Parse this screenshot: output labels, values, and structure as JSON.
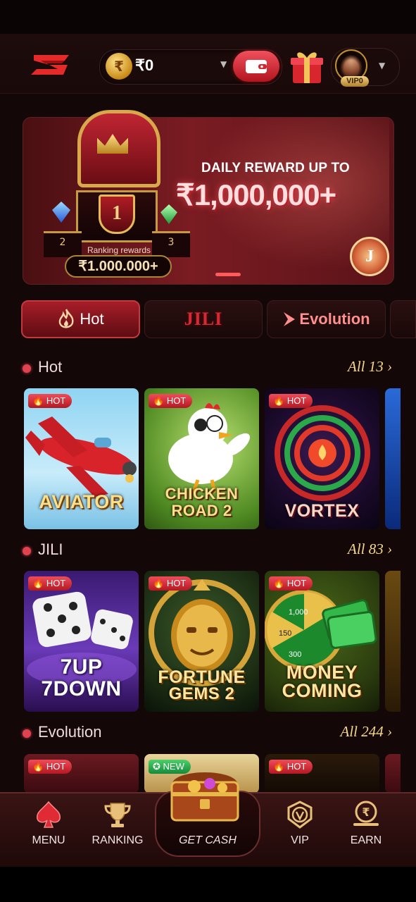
{
  "header": {
    "currency_symbol": "₹",
    "balance": "₹0",
    "vip_badge": "VIP0"
  },
  "banner": {
    "headline": "DAILY REWARD UP TO",
    "amount": "₹1,000,000+",
    "podium_first": "1",
    "podium_second": "2",
    "podium_third": "3",
    "ranking_label": "Ranking rewards",
    "ranking_amount": "₹1.000.000+"
  },
  "tabs": [
    {
      "label": "Hot",
      "active": true
    },
    {
      "label": "JILI",
      "active": false
    },
    {
      "label": "Evolution",
      "active": false
    }
  ],
  "sections": {
    "hot": {
      "title": "Hot",
      "all": "All 13",
      "games": [
        {
          "badge": "HOT",
          "title": "AVIATOR"
        },
        {
          "badge": "HOT",
          "title": "CHICKEN ROAD 2"
        },
        {
          "badge": "HOT",
          "title": "VORTEX"
        }
      ]
    },
    "jili": {
      "title": "JILI",
      "all": "All 83",
      "games": [
        {
          "badge": "HOT",
          "title_line1": "7UP",
          "title_line2": "7DOWN"
        },
        {
          "badge": "HOT",
          "title_line1": "FORTUNE",
          "title_line2": "GEMS 2"
        },
        {
          "badge": "HOT",
          "title_line1": "MONEY",
          "title_line2": "COMING"
        }
      ]
    },
    "evolution": {
      "title": "Evolution",
      "all": "All 244",
      "games": [
        {
          "badge": "HOT"
        },
        {
          "badge": "NEW"
        },
        {
          "badge": "HOT"
        }
      ]
    }
  },
  "bottom_nav": {
    "menu": "MENU",
    "ranking": "RANKING",
    "get_cash": "GET CASH",
    "vip": "VIP",
    "earn": "EARN"
  },
  "colors": {
    "accent": "#e0434f",
    "gold": "#f5d78a",
    "background": "#140708"
  }
}
